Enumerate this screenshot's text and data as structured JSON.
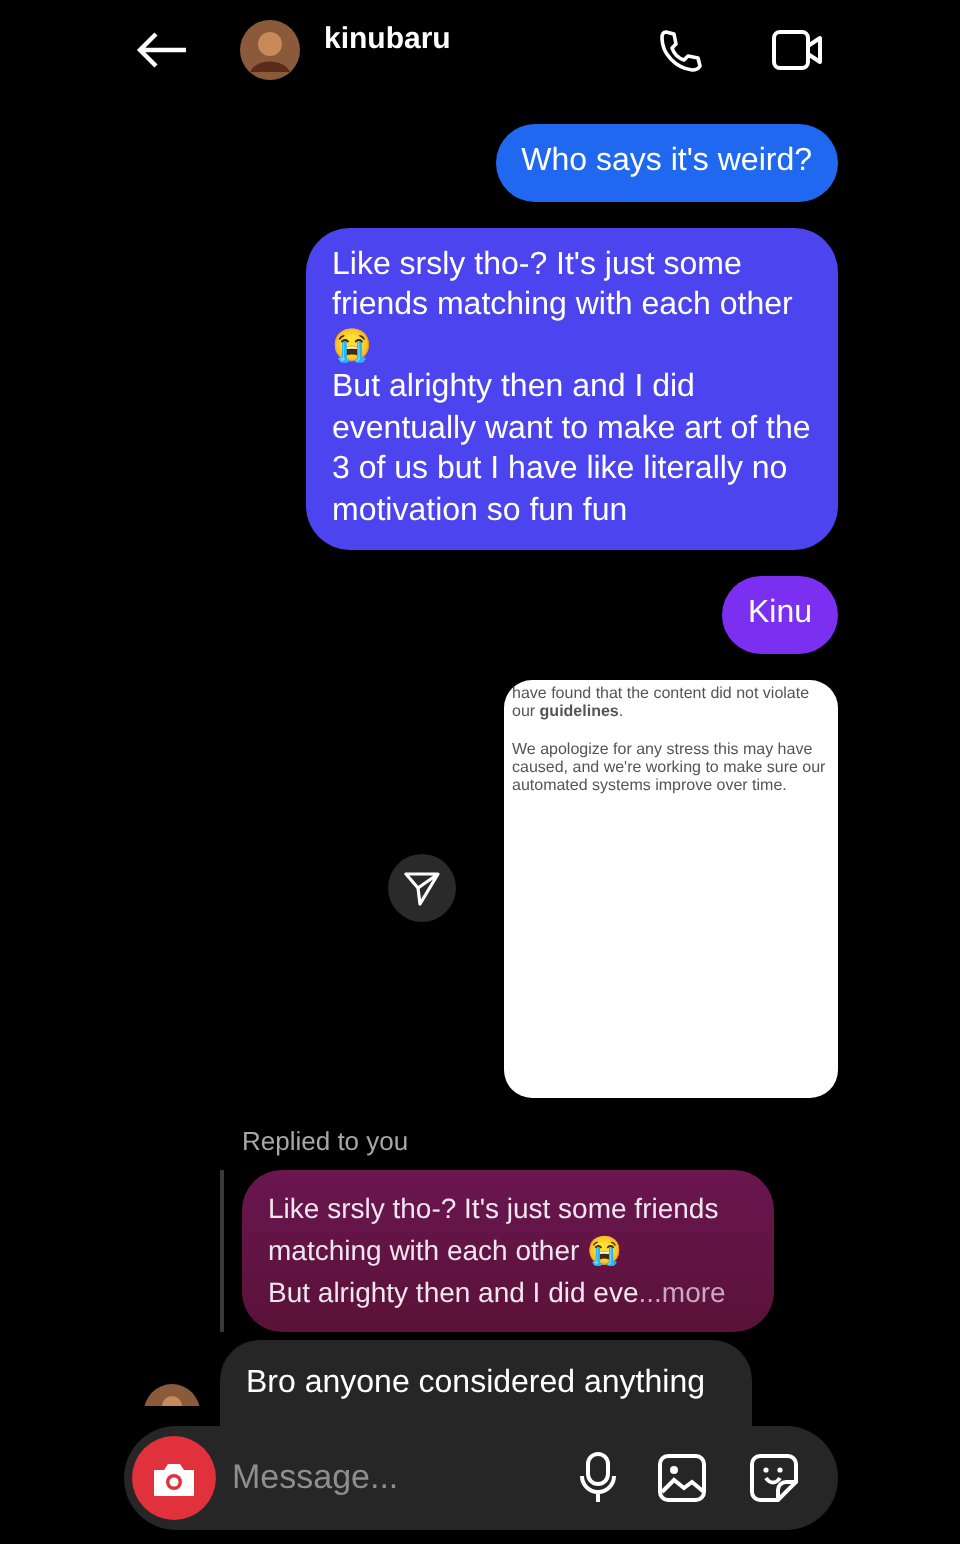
{
  "header": {
    "username": "kinubaru"
  },
  "messages": [
    {
      "kind": "sent",
      "text": "Who says it's weird?",
      "color": "#2068ef"
    },
    {
      "kind": "sent",
      "text": "Like srsly tho-? It's just some friends matching with each other 😭\nBut alrighty then and I did eventually want to make art of the 3 of us but I have like literally no motivation so fun fun",
      "color": "#4c44ee"
    },
    {
      "kind": "sent",
      "text": "Kinu",
      "color": "#7b2ff0"
    },
    {
      "kind": "screenshot",
      "paragraphs": [
        "have found that the content did not violate our **guidelines**.",
        "We apologize for any stress this may have caused, and we're working to make sure our automated systems improve over time."
      ]
    },
    {
      "kind": "reply",
      "label": "Replied to you",
      "quote": "Like srsly tho-? It's just some friends matching with each other 😭\nBut alrighty then and I did eve",
      "more": "...more",
      "text": "Bro anyone considered anything"
    }
  ],
  "composer": {
    "placeholder": "Message..."
  }
}
